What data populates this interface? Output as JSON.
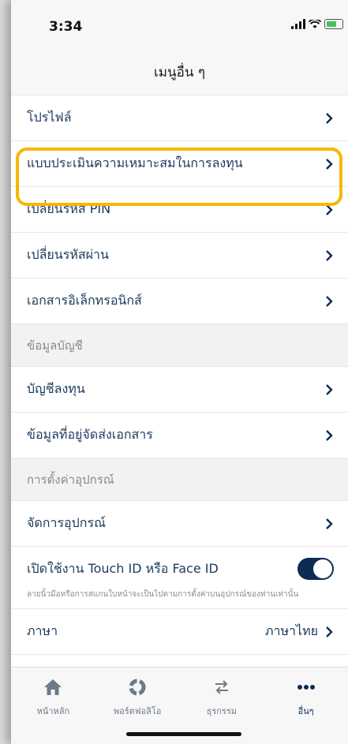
{
  "status_bar": {
    "time": "3:34"
  },
  "header": {
    "title": "เมนูอื่น ๆ"
  },
  "menu_items": [
    {
      "label": "โปรไฟล์"
    },
    {
      "label": "แบบประเมินความเหมาะสมในการลงทุน"
    },
    {
      "label": "เปลี่ยนรหัส PIN"
    },
    {
      "label": "เปลี่ยนรหัสผ่าน"
    },
    {
      "label": "เอกสารอิเล็กทรอนิกส์"
    }
  ],
  "account_section": {
    "title": "ข้อมูลบัญชี",
    "items": [
      {
        "label": "บัญชีลงทุน"
      },
      {
        "label": "ข้อมูลที่อยู่จัดส่งเอกสาร"
      }
    ]
  },
  "device_section": {
    "title": "การตั้งค่าอุปกรณ์",
    "items": [
      {
        "label": "จัดการอุปกรณ์"
      }
    ],
    "touch_id": {
      "label": "เปิดใช้งาน Touch ID หรือ Face ID",
      "enabled": true,
      "note": "ลายนิ้วมือหรือการสแกนใบหน้าจะเป็นไปตามการตั้งค่าบนอุปกรณ์ของท่านเท่านั้น"
    },
    "language": {
      "label": "ภาษา",
      "value": "ภาษาไทย"
    }
  },
  "tabbar": {
    "tabs": [
      {
        "label": "หน้าหลัก",
        "icon": "home-icon"
      },
      {
        "label": "พอร์ตฟอลิโอ",
        "icon": "portfolio-icon"
      },
      {
        "label": "ธุรกรรม",
        "icon": "transfer-icon"
      },
      {
        "label": "อื่นๆ",
        "icon": "more-icon"
      }
    ]
  },
  "colors": {
    "accent": "#0c2c55",
    "highlight": "#f5b800",
    "text": "#1a3a5c"
  }
}
